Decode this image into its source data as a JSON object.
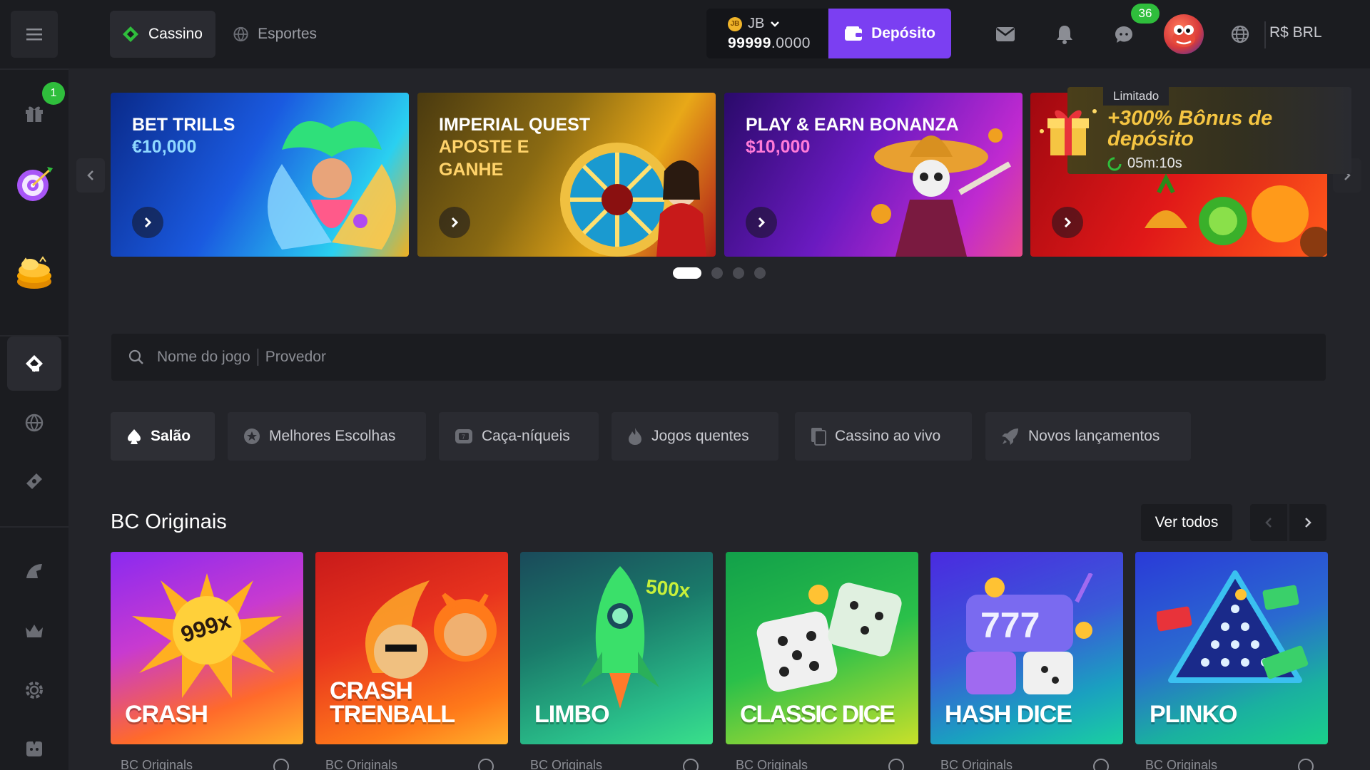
{
  "topbar": {
    "tabs": [
      {
        "label": "Cassino",
        "active": true
      },
      {
        "label": "Esportes",
        "active": false
      }
    ],
    "wallet": {
      "currency_code": "JB",
      "balance_int": "99999",
      "balance_dec": ".0000",
      "coin_label": "JB"
    },
    "deposit_label": "Depósito",
    "chat_badge": "36",
    "currency": "R$ BRL"
  },
  "sidebar": {
    "gift_badge": "1",
    "icons": [
      "menu-icon",
      "gift-icon",
      "spin-wheel-icon",
      "coin-stack-icon",
      "casino-icon",
      "sports-icon",
      "lottery-icon",
      "racing-icon",
      "vip-crown-icon",
      "settings-icon",
      "support-icon"
    ]
  },
  "banners": [
    {
      "title": "BET TRILLS",
      "sub": "€10,000"
    },
    {
      "title": "IMPERIAL QUEST",
      "sub": "APOSTE E GANHE"
    },
    {
      "title": "PLAY & EARN BONANZA",
      "sub": "$10,000"
    },
    {
      "title": "",
      "sub": ""
    }
  ],
  "promo": {
    "tag": "Limitado",
    "text": "+300% Bônus de depósito",
    "timer": "05m:10s"
  },
  "carousel": {
    "active_index": 0,
    "count": 4
  },
  "search": {
    "placeholder_a": "Nome do jogo",
    "placeholder_b": "Provedor"
  },
  "categories": [
    {
      "label": "Salão",
      "icon": "spade-icon",
      "active": true
    },
    {
      "label": "Melhores Escolhas",
      "icon": "star-badge-icon",
      "active": false
    },
    {
      "label": "Caça-níqueis",
      "icon": "slot-icon",
      "active": false
    },
    {
      "label": "Jogos quentes",
      "icon": "flame-icon",
      "active": false
    },
    {
      "label": "Cassino ao vivo",
      "icon": "cards-icon",
      "active": false
    },
    {
      "label": "Novos lançamentos",
      "icon": "rocket-icon",
      "active": false
    }
  ],
  "section": {
    "title": "BC Originais",
    "view_all": "Ver todos"
  },
  "games": [
    {
      "name": "CRASH",
      "tag": "999x",
      "sub": "BC Originals",
      "colors": [
        "#7a2cf0",
        "#ff8a1a"
      ]
    },
    {
      "name": "CRASH TRENBALL",
      "tag": "",
      "sub": "BC Originals",
      "colors": [
        "#e6331e",
        "#ff9a2a"
      ]
    },
    {
      "name": "LIMBO",
      "tag": "500x",
      "sub": "BC Originals",
      "colors": [
        "#1a6e6a",
        "#2fcf8a"
      ]
    },
    {
      "name": "CLASSIC DICE",
      "tag": "",
      "sub": "BC Originals",
      "colors": [
        "#1fae4a",
        "#c8e62a"
      ]
    },
    {
      "name": "HASH DICE",
      "tag": "",
      "sub": "BC Originals",
      "colors": [
        "#3a3ad0",
        "#1fd0b0"
      ]
    },
    {
      "name": "PLINKO",
      "tag": "",
      "sub": "BC Originals",
      "colors": [
        "#2a4ad8",
        "#1fd08a"
      ]
    }
  ]
}
